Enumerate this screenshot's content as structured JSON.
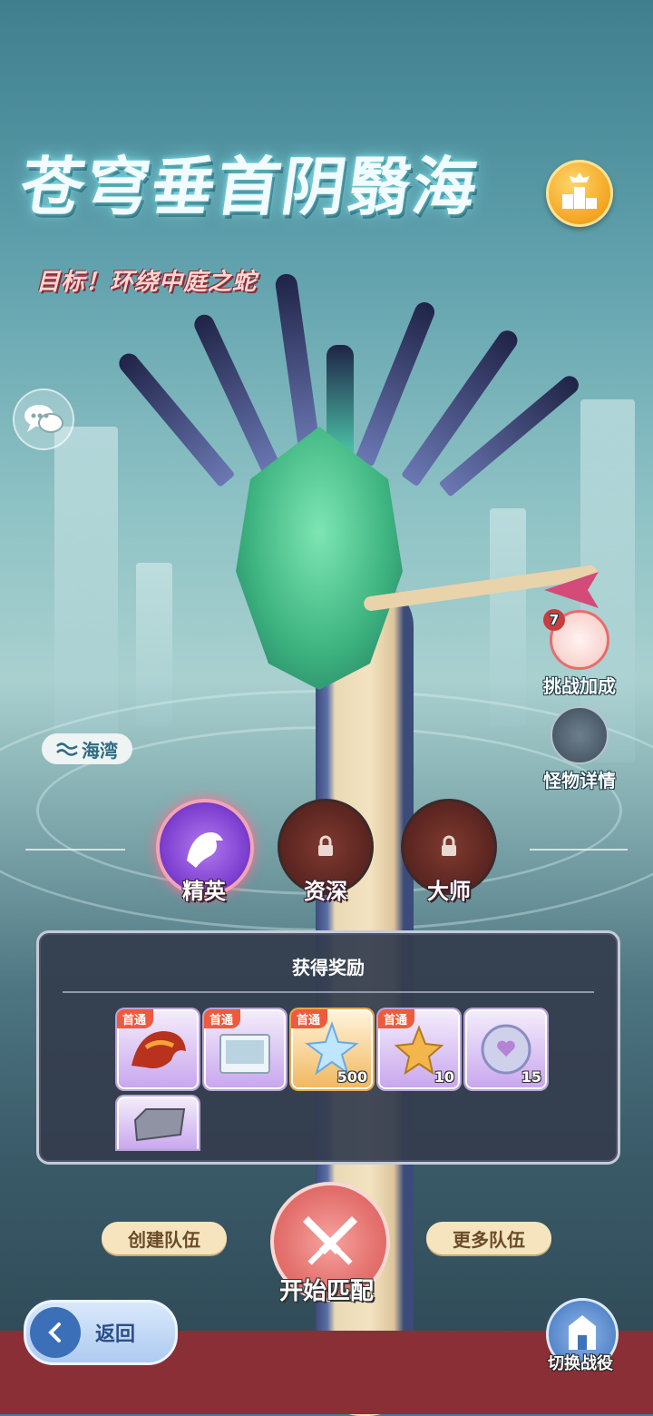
{
  "event": {
    "title": "苍穹垂首阴翳海",
    "subtitle": "目标！环绕中庭之蛇"
  },
  "side_buttons": {
    "challenge_bonus": {
      "label": "挑战加成",
      "badge": "7"
    },
    "monster_details": {
      "label": "怪物详情"
    }
  },
  "location_tag": "海湾",
  "difficulties": [
    {
      "label": "精英",
      "state": "selected"
    },
    {
      "label": "资深",
      "state": "locked"
    },
    {
      "label": "大师",
      "state": "locked"
    }
  ],
  "rewards": {
    "title": "获得奖励",
    "items": [
      {
        "name": "flame-dragon",
        "tag": "首通",
        "count": ""
      },
      {
        "name": "picture-card",
        "tag": "首通",
        "count": ""
      },
      {
        "name": "star-crystal",
        "tag": "首通",
        "count": "500"
      },
      {
        "name": "gold-star",
        "tag": "首通",
        "count": "10"
      },
      {
        "name": "heart-coin",
        "tag": "",
        "count": "15"
      },
      {
        "name": "iron-ingot",
        "tag": "",
        "count": ""
      }
    ]
  },
  "actions": {
    "create_team": "创建队伍",
    "start_match": "开始匹配",
    "more_teams": "更多队伍",
    "back": "返回",
    "switch_campaign": "切换战役"
  },
  "colors": {
    "selected_difficulty": "#8a4bd6",
    "locked_difficulty": "#6b2a24",
    "start_button": "#e4716d",
    "panel_bg": "#343c4e"
  }
}
